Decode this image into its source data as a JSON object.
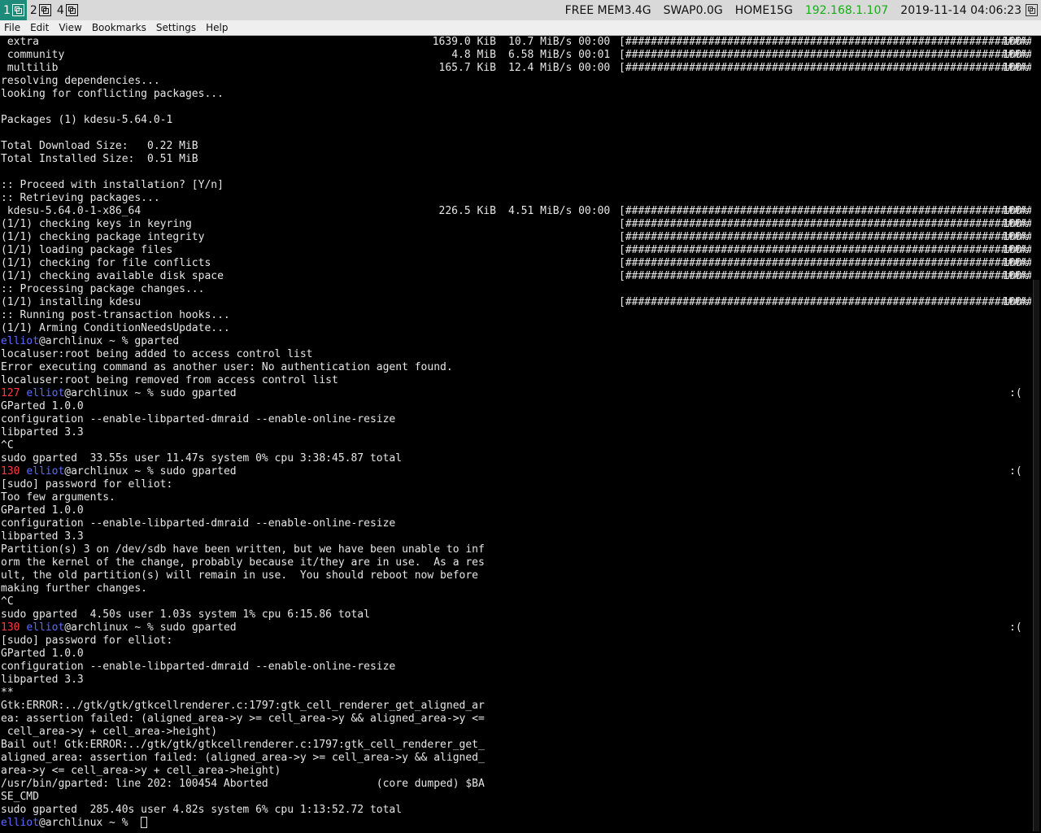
{
  "topbar": {
    "workspaces": [
      {
        "num": "1",
        "active": true
      },
      {
        "num": "2",
        "active": false
      },
      {
        "num": "4",
        "active": false
      }
    ],
    "mem": "FREE MEM3.4G",
    "swap": "SWAP0.0G",
    "home": "HOME15G",
    "ip": "192.168.1.107",
    "datetime": "2019-11-14 04:06:23"
  },
  "menu": [
    "File",
    "Edit",
    "View",
    "Bookmarks",
    "Settings",
    "Help"
  ],
  "colors": {
    "accent": "#1e8a7a",
    "ip": "#12b012",
    "prompt_user": "#5c6bff",
    "exit_code": "#ff3b3b"
  },
  "terminal": {
    "lines": [
      {
        "kind": "dl",
        "name": " extra",
        "size": "1639.0 KiB",
        "rate": "10.7 MiB/s 00:00",
        "bar": "[######################################################################]",
        "pct": "100%"
      },
      {
        "kind": "dl",
        "name": " community",
        "size": "4.8 MiB",
        "rate": "6.58 MiB/s 00:01",
        "bar": "[######################################################################]",
        "pct": "100%"
      },
      {
        "kind": "dl",
        "name": " multilib",
        "size": "165.7 KiB",
        "rate": "12.4 MiB/s 00:00",
        "bar": "[######################################################################]",
        "pct": "100%"
      },
      {
        "kind": "text",
        "text": "resolving dependencies..."
      },
      {
        "kind": "text",
        "text": "looking for conflicting packages..."
      },
      {
        "kind": "text",
        "text": ""
      },
      {
        "kind": "text",
        "text": "Packages (1) kdesu-5.64.0-1"
      },
      {
        "kind": "text",
        "text": ""
      },
      {
        "kind": "text",
        "text": "Total Download Size:   0.22 MiB"
      },
      {
        "kind": "text",
        "text": "Total Installed Size:  0.51 MiB"
      },
      {
        "kind": "text",
        "text": ""
      },
      {
        "kind": "text",
        "text": ":: Proceed with installation? [Y/n]"
      },
      {
        "kind": "text",
        "text": ":: Retrieving packages..."
      },
      {
        "kind": "dl",
        "name": " kdesu-5.64.0-1-x86_64",
        "size": "226.5 KiB",
        "rate": "4.51 MiB/s 00:00",
        "bar": "[######################################################################]",
        "pct": "100%"
      },
      {
        "kind": "bar",
        "text": "(1/1) checking keys in keyring",
        "bar": "[######################################################################]",
        "pct": "100%"
      },
      {
        "kind": "bar",
        "text": "(1/1) checking package integrity",
        "bar": "[######################################################################]",
        "pct": "100%"
      },
      {
        "kind": "bar",
        "text": "(1/1) loading package files",
        "bar": "[######################################################################]",
        "pct": "100%"
      },
      {
        "kind": "bar",
        "text": "(1/1) checking for file conflicts",
        "bar": "[######################################################################]",
        "pct": "100%"
      },
      {
        "kind": "bar",
        "text": "(1/1) checking available disk space",
        "bar": "[######################################################################]",
        "pct": "100%"
      },
      {
        "kind": "text",
        "text": ":: Processing package changes..."
      },
      {
        "kind": "bar",
        "text": "(1/1) installing kdesu",
        "bar": "[######################################################################]",
        "pct": "100%"
      },
      {
        "kind": "text",
        "text": ":: Running post-transaction hooks..."
      },
      {
        "kind": "text",
        "text": "(1/1) Arming ConditionNeedsUpdate..."
      },
      {
        "kind": "prompt",
        "code": "",
        "user": "elliot",
        "rest": "@archlinux ~ % gparted",
        "right": ""
      },
      {
        "kind": "text",
        "text": "localuser:root being added to access control list"
      },
      {
        "kind": "text",
        "text": "Error executing command as another user: No authentication agent found."
      },
      {
        "kind": "text",
        "text": "localuser:root being removed from access control list"
      },
      {
        "kind": "prompt",
        "code": "127",
        "user": "elliot",
        "rest": "@archlinux ~ % sudo gparted",
        "right": ":("
      },
      {
        "kind": "text",
        "text": "GParted 1.0.0"
      },
      {
        "kind": "text",
        "text": "configuration --enable-libparted-dmraid --enable-online-resize"
      },
      {
        "kind": "text",
        "text": "libparted 3.3"
      },
      {
        "kind": "text",
        "text": "^C"
      },
      {
        "kind": "text",
        "text": "sudo gparted  33.55s user 11.47s system 0% cpu 3:38:45.87 total"
      },
      {
        "kind": "prompt",
        "code": "130",
        "user": "elliot",
        "rest": "@archlinux ~ % sudo gparted",
        "right": ":("
      },
      {
        "kind": "text",
        "text": "[sudo] password for elliot:"
      },
      {
        "kind": "text",
        "text": "Too few arguments."
      },
      {
        "kind": "text",
        "text": "GParted 1.0.0"
      },
      {
        "kind": "text",
        "text": "configuration --enable-libparted-dmraid --enable-online-resize"
      },
      {
        "kind": "text",
        "text": "libparted 3.3"
      },
      {
        "kind": "text",
        "text": "Partition(s) 3 on /dev/sdb have been written, but we have been unable to inf"
      },
      {
        "kind": "text",
        "text": "orm the kernel of the change, probably because it/they are in use.  As a res"
      },
      {
        "kind": "text",
        "text": "ult, the old partition(s) will remain in use.  You should reboot now before"
      },
      {
        "kind": "text",
        "text": "making further changes."
      },
      {
        "kind": "text",
        "text": "^C"
      },
      {
        "kind": "text",
        "text": "sudo gparted  4.50s user 1.03s system 1% cpu 6:15.86 total"
      },
      {
        "kind": "prompt",
        "code": "130",
        "user": "elliot",
        "rest": "@archlinux ~ % sudo gparted",
        "right": ":("
      },
      {
        "kind": "text",
        "text": "[sudo] password for elliot:"
      },
      {
        "kind": "text",
        "text": "GParted 1.0.0"
      },
      {
        "kind": "text",
        "text": "configuration --enable-libparted-dmraid --enable-online-resize"
      },
      {
        "kind": "text",
        "text": "libparted 3.3"
      },
      {
        "kind": "text",
        "text": "**"
      },
      {
        "kind": "text",
        "text": "Gtk:ERROR:../gtk/gtk/gtkcellrenderer.c:1797:gtk_cell_renderer_get_aligned_ar"
      },
      {
        "kind": "text",
        "text": "ea: assertion failed: (aligned_area->y >= cell_area->y && aligned_area->y <="
      },
      {
        "kind": "text",
        "text": " cell_area->y + cell_area->height)"
      },
      {
        "kind": "text",
        "text": "Bail out! Gtk:ERROR:../gtk/gtk/gtkcellrenderer.c:1797:gtk_cell_renderer_get_"
      },
      {
        "kind": "text",
        "text": "aligned_area: assertion failed: (aligned_area->y >= cell_area->y && aligned_"
      },
      {
        "kind": "text",
        "text": "area->y <= cell_area->y + cell_area->height)"
      },
      {
        "kind": "text",
        "text": "/usr/bin/gparted: line 202: 100454 Aborted                 (core dumped) $BA"
      },
      {
        "kind": "text",
        "text": "SE_CMD"
      },
      {
        "kind": "text",
        "text": "sudo gparted  285.40s user 4.82s system 6% cpu 1:13:52.72 total"
      },
      {
        "kind": "prompt",
        "code": "",
        "user": "elliot",
        "rest": "@archlinux ~ %  ",
        "right": "",
        "cursor": true
      }
    ]
  }
}
